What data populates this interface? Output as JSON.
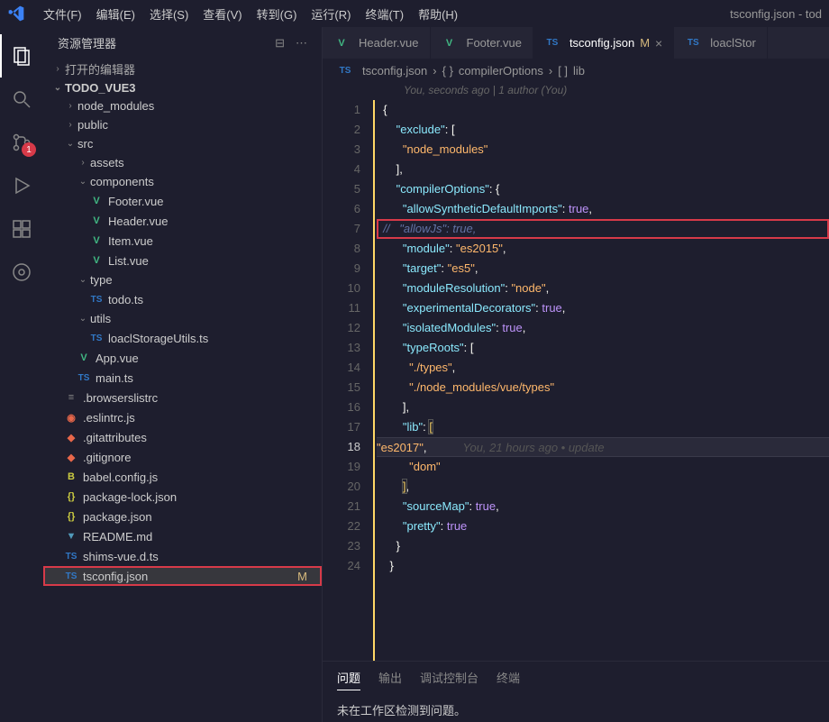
{
  "menubar": {
    "items": [
      "文件(F)",
      "编辑(E)",
      "选择(S)",
      "查看(V)",
      "转到(G)",
      "运行(R)",
      "终端(T)",
      "帮助(H)"
    ],
    "title": "tsconfig.json - tod"
  },
  "activitybar": {
    "scm_badge": "1"
  },
  "sidebar": {
    "title": "资源管理器",
    "open_editors": "打开的编辑器",
    "project": "TODO_VUE3",
    "tree": [
      {
        "type": "folder",
        "name": "node_modules",
        "depth": 1,
        "open": false
      },
      {
        "type": "folder",
        "name": "public",
        "depth": 1,
        "open": false
      },
      {
        "type": "folder",
        "name": "src",
        "depth": 1,
        "open": true
      },
      {
        "type": "folder",
        "name": "assets",
        "depth": 2,
        "open": false
      },
      {
        "type": "folder",
        "name": "components",
        "depth": 2,
        "open": true
      },
      {
        "type": "file",
        "name": "Footer.vue",
        "depth": 3,
        "icon": "vue"
      },
      {
        "type": "file",
        "name": "Header.vue",
        "depth": 3,
        "icon": "vue"
      },
      {
        "type": "file",
        "name": "Item.vue",
        "depth": 3,
        "icon": "vue"
      },
      {
        "type": "file",
        "name": "List.vue",
        "depth": 3,
        "icon": "vue"
      },
      {
        "type": "folder",
        "name": "type",
        "depth": 2,
        "open": true
      },
      {
        "type": "file",
        "name": "todo.ts",
        "depth": 3,
        "icon": "ts"
      },
      {
        "type": "folder",
        "name": "utils",
        "depth": 2,
        "open": true
      },
      {
        "type": "file",
        "name": "loaclStorageUtils.ts",
        "depth": 3,
        "icon": "ts"
      },
      {
        "type": "file",
        "name": "App.vue",
        "depth": 2,
        "icon": "vue"
      },
      {
        "type": "file",
        "name": "main.ts",
        "depth": 2,
        "icon": "ts"
      },
      {
        "type": "file",
        "name": ".browserslistrc",
        "depth": 1,
        "icon": "config"
      },
      {
        "type": "file",
        "name": ".eslintrc.js",
        "depth": 1,
        "icon": "eslint"
      },
      {
        "type": "file",
        "name": ".gitattributes",
        "depth": 1,
        "icon": "git"
      },
      {
        "type": "file",
        "name": ".gitignore",
        "depth": 1,
        "icon": "git"
      },
      {
        "type": "file",
        "name": "babel.config.js",
        "depth": 1,
        "icon": "babel"
      },
      {
        "type": "file",
        "name": "package-lock.json",
        "depth": 1,
        "icon": "json"
      },
      {
        "type": "file",
        "name": "package.json",
        "depth": 1,
        "icon": "json"
      },
      {
        "type": "file",
        "name": "README.md",
        "depth": 1,
        "icon": "md"
      },
      {
        "type": "file",
        "name": "shims-vue.d.ts",
        "depth": 1,
        "icon": "ts"
      },
      {
        "type": "file",
        "name": "tsconfig.json",
        "depth": 1,
        "icon": "ts",
        "selected": true,
        "modified": "M",
        "highlighted": true
      }
    ]
  },
  "tabs": [
    {
      "label": "Header.vue",
      "icon": "vue"
    },
    {
      "label": "Footer.vue",
      "icon": "vue"
    },
    {
      "label": "tsconfig.json",
      "icon": "ts",
      "modified": "M",
      "active": true
    },
    {
      "label": "loaclStor",
      "icon": "ts"
    }
  ],
  "breadcrumb": {
    "file": "tsconfig.json",
    "sym1": "compilerOptions",
    "sym2": "lib"
  },
  "blame_header": "You, seconds ago | 1 author (You)",
  "code_lines": [
    {
      "n": 1,
      "tokens": [
        {
          "t": "{",
          "c": "punct"
        }
      ]
    },
    {
      "n": 2,
      "tokens": [
        {
          "t": "    ",
          "c": ""
        },
        {
          "t": "\"exclude\"",
          "c": "key"
        },
        {
          "t": ": [",
          "c": "punct"
        }
      ]
    },
    {
      "n": 3,
      "tokens": [
        {
          "t": "      ",
          "c": ""
        },
        {
          "t": "\"node_modules\"",
          "c": "str"
        }
      ]
    },
    {
      "n": 4,
      "tokens": [
        {
          "t": "    ],",
          "c": "punct"
        }
      ]
    },
    {
      "n": 5,
      "tokens": [
        {
          "t": "    ",
          "c": ""
        },
        {
          "t": "\"compilerOptions\"",
          "c": "key"
        },
        {
          "t": ": {",
          "c": "punct"
        }
      ]
    },
    {
      "n": 6,
      "tokens": [
        {
          "t": "      ",
          "c": ""
        },
        {
          "t": "\"allowSyntheticDefaultImports\"",
          "c": "key"
        },
        {
          "t": ": ",
          "c": "punct"
        },
        {
          "t": "true",
          "c": "bool"
        },
        {
          "t": ",",
          "c": "punct"
        }
      ]
    },
    {
      "n": 7,
      "highlighted": true,
      "tokens": [
        {
          "t": "//   \"allowJs\": true,",
          "c": "comment"
        }
      ]
    },
    {
      "n": 8,
      "tokens": [
        {
          "t": "      ",
          "c": ""
        },
        {
          "t": "\"module\"",
          "c": "key"
        },
        {
          "t": ": ",
          "c": "punct"
        },
        {
          "t": "\"es2015\"",
          "c": "str"
        },
        {
          "t": ",",
          "c": "punct"
        }
      ]
    },
    {
      "n": 9,
      "tokens": [
        {
          "t": "      ",
          "c": ""
        },
        {
          "t": "\"target\"",
          "c": "key"
        },
        {
          "t": ": ",
          "c": "punct"
        },
        {
          "t": "\"es5\"",
          "c": "str"
        },
        {
          "t": ",",
          "c": "punct"
        }
      ]
    },
    {
      "n": 10,
      "tokens": [
        {
          "t": "      ",
          "c": ""
        },
        {
          "t": "\"moduleResolution\"",
          "c": "key"
        },
        {
          "t": ": ",
          "c": "punct"
        },
        {
          "t": "\"node\"",
          "c": "str"
        },
        {
          "t": ",",
          "c": "punct"
        }
      ]
    },
    {
      "n": 11,
      "tokens": [
        {
          "t": "      ",
          "c": ""
        },
        {
          "t": "\"experimentalDecorators\"",
          "c": "key"
        },
        {
          "t": ": ",
          "c": "punct"
        },
        {
          "t": "true",
          "c": "bool"
        },
        {
          "t": ",",
          "c": "punct"
        }
      ]
    },
    {
      "n": 12,
      "tokens": [
        {
          "t": "      ",
          "c": ""
        },
        {
          "t": "\"isolatedModules\"",
          "c": "key"
        },
        {
          "t": ": ",
          "c": "punct"
        },
        {
          "t": "true",
          "c": "bool"
        },
        {
          "t": ",",
          "c": "punct"
        }
      ]
    },
    {
      "n": 13,
      "tokens": [
        {
          "t": "      ",
          "c": ""
        },
        {
          "t": "\"typeRoots\"",
          "c": "key"
        },
        {
          "t": ": [",
          "c": "punct"
        }
      ]
    },
    {
      "n": 14,
      "tokens": [
        {
          "t": "        ",
          "c": ""
        },
        {
          "t": "\"./types\"",
          "c": "str"
        },
        {
          "t": ",",
          "c": "punct"
        }
      ]
    },
    {
      "n": 15,
      "tokens": [
        {
          "t": "        ",
          "c": ""
        },
        {
          "t": "\"./node_modules/vue/types\"",
          "c": "str"
        }
      ]
    },
    {
      "n": 16,
      "tokens": [
        {
          "t": "      ],",
          "c": "punct"
        }
      ]
    },
    {
      "n": 17,
      "tokens": [
        {
          "t": "      ",
          "c": ""
        },
        {
          "t": "\"lib\"",
          "c": "key"
        },
        {
          "t": ": ",
          "c": "punct"
        },
        {
          "t": "[",
          "c": "bracket"
        }
      ]
    },
    {
      "n": 18,
      "current": true,
      "tokens": [
        {
          "t": "        ",
          "c": ""
        },
        {
          "t": "\"es2017\"",
          "c": "str"
        },
        {
          "t": ",",
          "c": "punct"
        }
      ],
      "blame": "You, 21 hours ago • update"
    },
    {
      "n": 19,
      "tokens": [
        {
          "t": "        ",
          "c": ""
        },
        {
          "t": "\"dom\"",
          "c": "str"
        }
      ]
    },
    {
      "n": 20,
      "tokens": [
        {
          "t": "      ",
          "c": ""
        },
        {
          "t": "]",
          "c": "bracket"
        },
        {
          "t": ",",
          "c": "punct"
        }
      ]
    },
    {
      "n": 21,
      "tokens": [
        {
          "t": "      ",
          "c": ""
        },
        {
          "t": "\"sourceMap\"",
          "c": "key"
        },
        {
          "t": ": ",
          "c": "punct"
        },
        {
          "t": "true",
          "c": "bool"
        },
        {
          "t": ",",
          "c": "punct"
        }
      ]
    },
    {
      "n": 22,
      "tokens": [
        {
          "t": "      ",
          "c": ""
        },
        {
          "t": "\"pretty\"",
          "c": "key"
        },
        {
          "t": ": ",
          "c": "punct"
        },
        {
          "t": "true",
          "c": "bool"
        }
      ]
    },
    {
      "n": 23,
      "tokens": [
        {
          "t": "    }",
          "c": "punct"
        }
      ]
    },
    {
      "n": 24,
      "tokens": [
        {
          "t": "  }",
          "c": "punct"
        }
      ]
    }
  ],
  "panel": {
    "tabs": [
      "问题",
      "输出",
      "调试控制台",
      "终端"
    ],
    "message": "未在工作区检测到问题。"
  }
}
